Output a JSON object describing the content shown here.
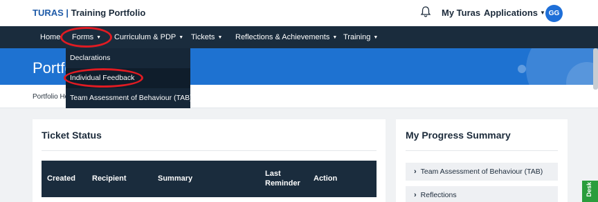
{
  "header": {
    "brand_turas": "TURAS",
    "brand_sep": "|",
    "brand_rest": "Training Portfolio",
    "my_turas": "My Turas",
    "applications": "Applications",
    "avatar_initials": "GG"
  },
  "nav": {
    "items": [
      {
        "label": "Home",
        "has_caret": false
      },
      {
        "label": "Forms",
        "has_caret": true
      },
      {
        "label": "Curriculum & PDP",
        "has_caret": true
      },
      {
        "label": "Tickets",
        "has_caret": true
      },
      {
        "label": "Reflections & Achievements",
        "has_caret": true
      },
      {
        "label": "Training",
        "has_caret": true
      }
    ],
    "caret": "▾"
  },
  "forms_menu": {
    "items": [
      {
        "label": "Declarations"
      },
      {
        "label": "Individual Feedback"
      },
      {
        "label": "Team Assessment of Behaviour (TAB)"
      }
    ]
  },
  "hero": {
    "title": "Portfolio"
  },
  "breadcrumb": {
    "text": "Portfolio Home"
  },
  "ticket_status": {
    "title": "Ticket Status",
    "columns": [
      "Created",
      "Recipient",
      "Summary",
      "Last Reminder",
      "Action"
    ]
  },
  "progress_summary": {
    "title": "My Progress Summary",
    "items": [
      "Team Assessment of Behaviour (TAB)",
      "Reflections"
    ]
  },
  "desk_tab": "Desk",
  "colors": {
    "nav_bg": "#1a2c3d",
    "hero_bg": "#1e72d1",
    "brand_blue": "#1f5ba8",
    "annotation_red": "#e01b22",
    "desk_green": "#2a9d3c"
  }
}
